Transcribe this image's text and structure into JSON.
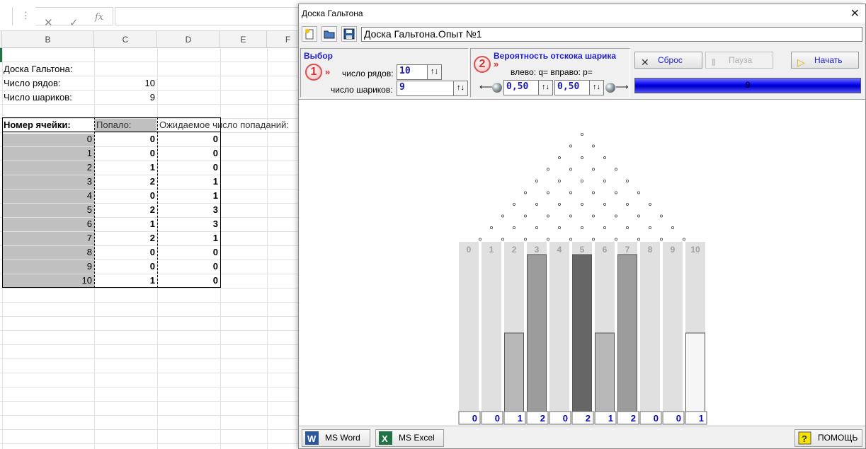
{
  "excel": {
    "columns": [
      "B",
      "C",
      "D",
      "E",
      "F"
    ],
    "formula_bar": {
      "cancel": "✕",
      "enter": "✓",
      "fx": "fx"
    },
    "label_title": "Доска Гальтона:",
    "label_rows": "Число рядов:",
    "value_rows": "10",
    "label_balls": "Число шариков:",
    "value_balls": "9",
    "table": {
      "headers": [
        "Номер ячейки:",
        "Попало:",
        "Ожидаемое число попаданий:"
      ],
      "rows": [
        [
          "0",
          "0",
          "0"
        ],
        [
          "1",
          "0",
          "0"
        ],
        [
          "2",
          "1",
          "0"
        ],
        [
          "3",
          "2",
          "1"
        ],
        [
          "4",
          "0",
          "1"
        ],
        [
          "5",
          "2",
          "3"
        ],
        [
          "6",
          "1",
          "3"
        ],
        [
          "7",
          "2",
          "1"
        ],
        [
          "8",
          "0",
          "0"
        ],
        [
          "9",
          "0",
          "0"
        ],
        [
          "10",
          "1",
          "0"
        ]
      ]
    }
  },
  "window": {
    "title": "Доска Гальтона",
    "close": "✕",
    "experiment_title": "Доска Гальтона.Опыт №1",
    "toolbar_icons": [
      "new-icon",
      "open-folder-icon",
      "save-icon"
    ],
    "group1": {
      "title": "Выбор",
      "badge": "1",
      "chevron": "»",
      "rows_label": "число рядов:",
      "rows_value": "10",
      "balls_label": "число шариков:",
      "balls_value": "9"
    },
    "group2": {
      "title": "Вероятность отскока шарика",
      "badge": "2",
      "chevron": "»",
      "prob_label": "влево: q= вправо: p=",
      "q_value": "0,50",
      "p_value": "0,50"
    },
    "buttons": {
      "reset": "Сброс",
      "pause": "Пауза",
      "start": "Начать"
    },
    "progress": {
      "value": "9",
      "fraction": 1.0
    },
    "board": {
      "rows": 10,
      "bins": [
        "0",
        "1",
        "2",
        "3",
        "4",
        "5",
        "6",
        "7",
        "8",
        "9",
        "10"
      ],
      "counts": [
        0,
        0,
        1,
        2,
        0,
        2,
        1,
        2,
        0,
        0,
        1
      ],
      "count_labels": [
        "0",
        "0",
        "1",
        "2",
        "0",
        "2",
        "1",
        "2",
        "0",
        "0",
        "1"
      ],
      "max_count": 2,
      "colors": {
        "slot_bg": "#e0e0e0",
        "bin_label": "#a0a0a0",
        "count_text": "#0000cc"
      }
    },
    "bottom": {
      "word": "MS Word",
      "excel": "MS Excel",
      "help": "ПОМОЩЬ"
    }
  }
}
